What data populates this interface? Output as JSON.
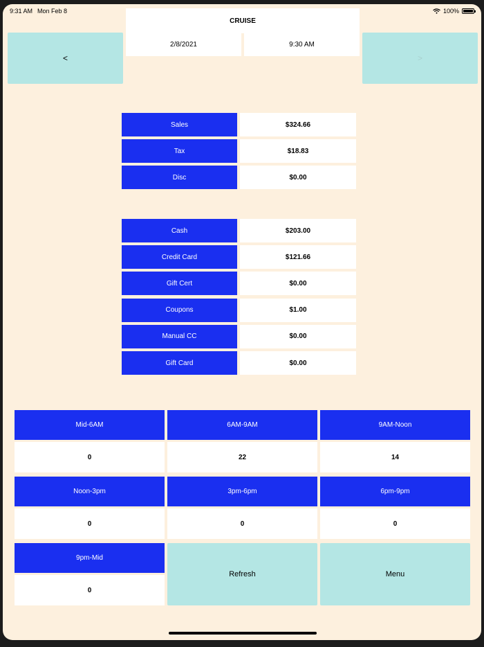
{
  "status_bar": {
    "time": "9:31 AM",
    "date": "Mon Feb 8",
    "battery": "100%",
    "battery_level": 1.0
  },
  "header": {
    "title": "CRUISE",
    "date": "2/8/2021",
    "time": "9:30 AM",
    "prev_label": "<",
    "next_label": ">"
  },
  "totals": [
    {
      "label": "Sales",
      "value": "$324.66"
    },
    {
      "label": "Tax",
      "value": "$18.83"
    },
    {
      "label": "Disc",
      "value": "$0.00"
    }
  ],
  "payments": [
    {
      "label": "Cash",
      "value": "$203.00"
    },
    {
      "label": "Credit Card",
      "value": "$121.66"
    },
    {
      "label": "Gift Cert",
      "value": "$0.00"
    },
    {
      "label": "Coupons",
      "value": "$1.00"
    },
    {
      "label": "Manual CC",
      "value": "$0.00"
    },
    {
      "label": "Gift Card",
      "value": "$0.00"
    }
  ],
  "time_slots": [
    {
      "label": "Mid-6AM",
      "value": "0"
    },
    {
      "label": "6AM-9AM",
      "value": "22"
    },
    {
      "label": "9AM-Noon",
      "value": "14"
    },
    {
      "label": "Noon-3pm",
      "value": "0"
    },
    {
      "label": "3pm-6pm",
      "value": "0"
    },
    {
      "label": "6pm-9pm",
      "value": "0"
    },
    {
      "label": "9pm-Mid",
      "value": "0"
    }
  ],
  "actions": {
    "refresh": "Refresh",
    "menu": "Menu"
  },
  "colors": {
    "background": "#fdf0de",
    "label_blue": "#1a2ff0",
    "button_teal": "#b4e6e4",
    "cell_white": "#ffffff"
  }
}
